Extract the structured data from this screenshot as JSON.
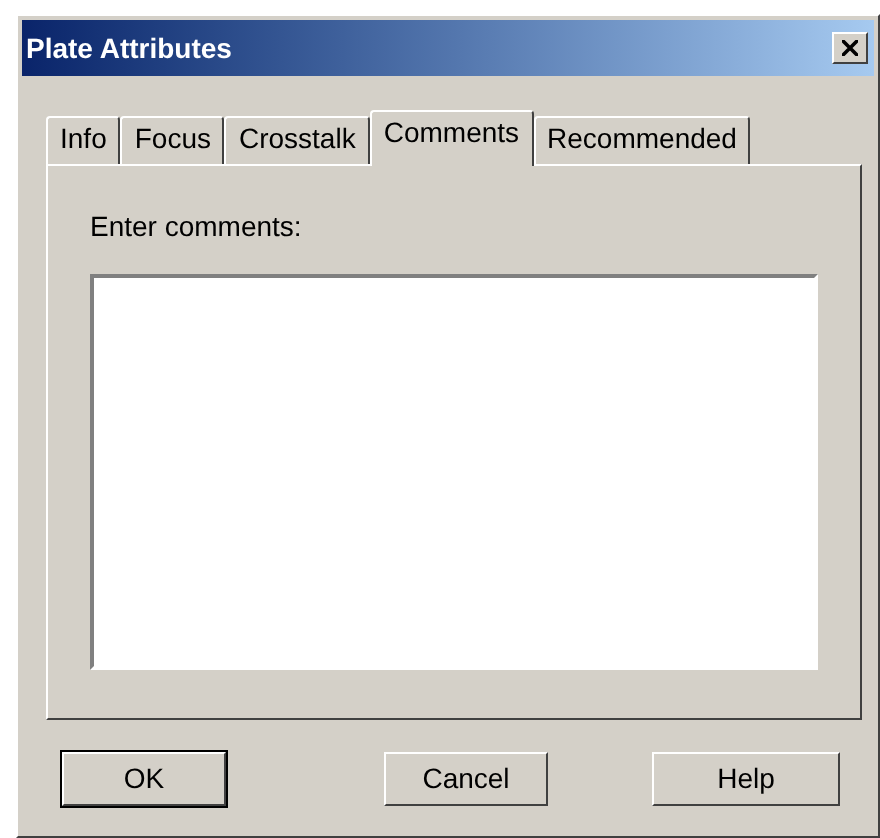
{
  "window": {
    "title": "Plate Attributes"
  },
  "tabs": [
    {
      "label": "Info",
      "selected": false
    },
    {
      "label": "Focus",
      "selected": false
    },
    {
      "label": "Crosstalk",
      "selected": false
    },
    {
      "label": "Comments",
      "selected": true
    },
    {
      "label": "Recommended",
      "selected": false
    }
  ],
  "comments": {
    "label": "Enter comments:"
  },
  "buttons": [
    {
      "label": "OK",
      "default": true
    },
    {
      "label": "Cancel",
      "default": false
    },
    {
      "label": "Help",
      "default": false
    }
  ]
}
